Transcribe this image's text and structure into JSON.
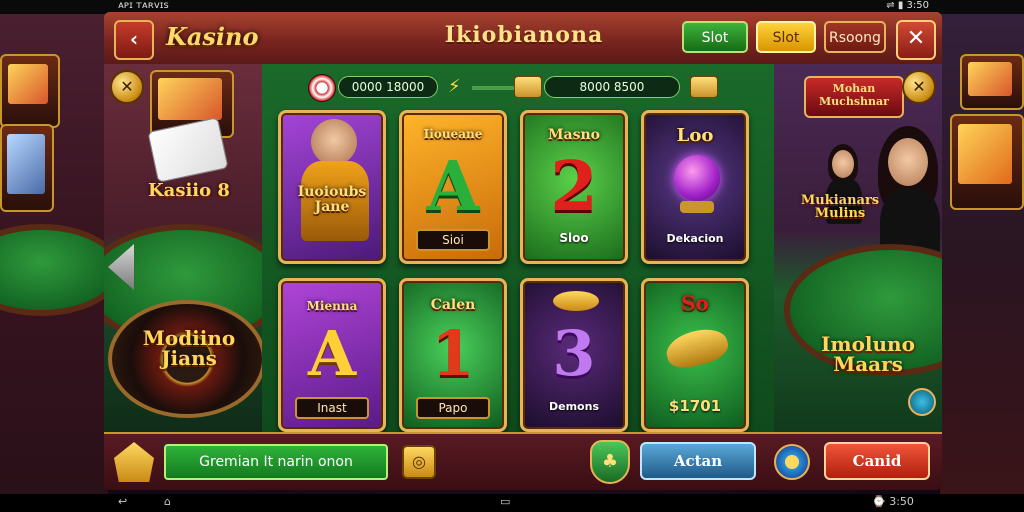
{
  "status_bar": {
    "left_text": "ᴀᴘɪ ᴛᴀʀᴠɪs",
    "right_text": "⇌ ▮ 3:50"
  },
  "header": {
    "back_icon": "chevron-left-icon",
    "logo": "Kasino",
    "title": "Ikiobianona",
    "buttons": [
      {
        "label": "Slot",
        "color": "#2a9a2a"
      },
      {
        "label": "Slot",
        "color": "#ffc21a"
      },
      {
        "label": "Rsoong",
        "color": "#8a2418"
      }
    ],
    "close_icon": "close-icon"
  },
  "balance": {
    "left_value": "0000  18000",
    "right_value": "8000  8500",
    "chip_icon": "poker-chip-icon",
    "bolt_icon": "lightning-icon",
    "ticket_icon": "ticket-icon"
  },
  "left_panel": {
    "caption_top": "Kasiio 8",
    "caption_bottom": "Modiino\nJians",
    "coin_icon": "coin-icon",
    "arrow_icon": "arrow-left-icon"
  },
  "right_panel": {
    "caption_top": "Mukianars\nMulins",
    "caption_bottom": "Imoluno\nMaars",
    "coin_icon": "coin-icon",
    "sign_text": "Mohan\nMuchshnar"
  },
  "tiles": [
    {
      "title": "Iuoioubs\nJane",
      "label": "",
      "bg": "#7a2aa8"
    },
    {
      "title": "Iioueane",
      "glyph": "A",
      "label": "Sioi",
      "bg": "#f0a21a"
    },
    {
      "title": "Masno",
      "glyph": "2",
      "label": "Sloo",
      "bg": "#3a9a2a"
    },
    {
      "title": "Loo",
      "label": "Dekacion",
      "bg": "#2a1a4a"
    },
    {
      "title": "Mienna",
      "glyph": "A",
      "label": "Inast",
      "bg": "#7a2aa8"
    },
    {
      "title": "Calen",
      "glyph": "1",
      "label": "Papo",
      "bg": "#1a8a3a"
    },
    {
      "title": "",
      "glyph": "3",
      "label": "Demons",
      "bg": "#3a1a4a"
    },
    {
      "title": "So",
      "label": "$1701",
      "bg": "#1a8a3a"
    }
  ],
  "footer": {
    "home_icon": "home-icon",
    "input_value": "Gremian It narin onon",
    "gold_icon": "star-coin-icon",
    "emblem_icon": "shield-emblem-icon",
    "action_label": "Actan",
    "gear_icon": "gear-icon",
    "cancel_label": "Canid"
  },
  "nav_bar": {
    "back": "↩",
    "home": "⌂",
    "recents": "▭",
    "right_text": "⌚ 3:50"
  }
}
